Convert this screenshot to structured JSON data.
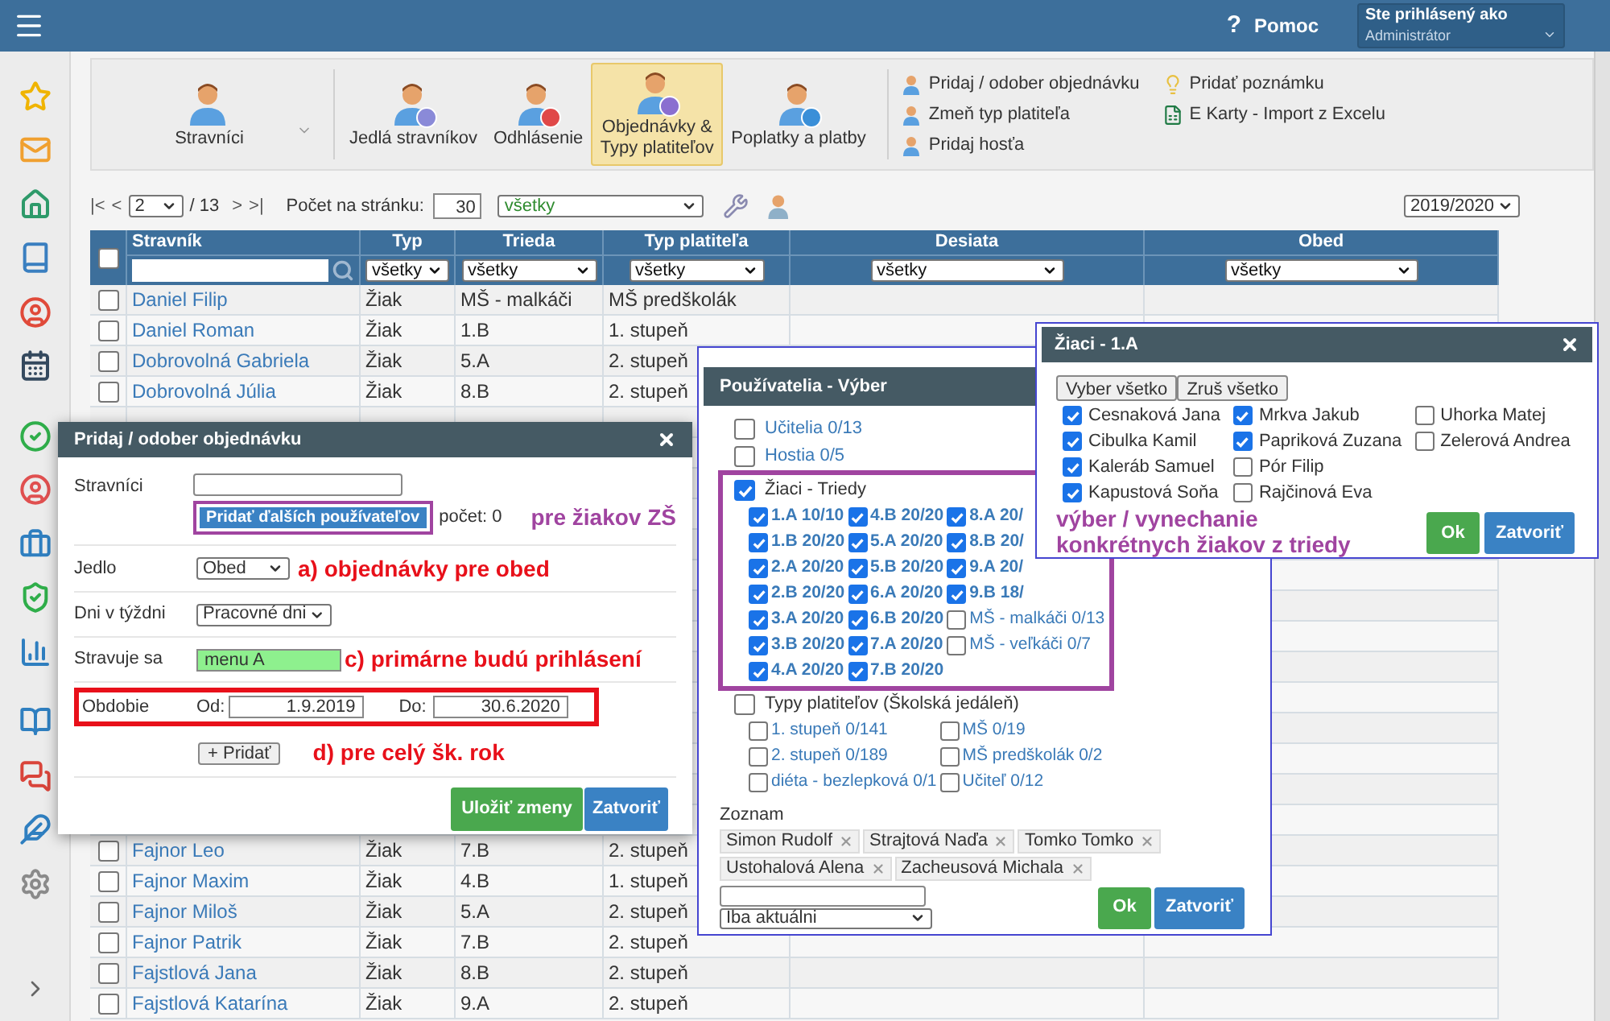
{
  "header": {
    "help_icon": "?",
    "help": "Pomoc",
    "user_label": "Ste prihlásený ako",
    "user_role": "Administrátor"
  },
  "toolbar": {
    "buttons": [
      {
        "label": "Stravníci",
        "selected": false,
        "dropdown": true
      },
      {
        "label": "Jedlá stravníkov",
        "selected": false,
        "dropdown": false
      },
      {
        "label": "Odhlásenie",
        "selected": false,
        "dropdown": false
      },
      {
        "label": "Objednávky & Typy platiteľov",
        "selected": true,
        "dropdown": false
      },
      {
        "label": "Poplatky a platby",
        "selected": false,
        "dropdown": false
      }
    ],
    "links": [
      "Pridaj / odober objednávku",
      "Zmeň typ platiteľa",
      "Pridaj hosťa",
      "Pridať poznámku",
      "E Karty - Import z Excelu"
    ]
  },
  "pager": {
    "first": "|<",
    "prev": "<",
    "page": "2",
    "total": "/ 13",
    "next": ">",
    "last": ">|",
    "per_page_label": "Počet na stránku:",
    "per_page": "30",
    "filter": "všetky",
    "year": "2019/2020"
  },
  "table": {
    "columns": [
      "Stravník",
      "Typ",
      "Trieda",
      "Typ platiteľa",
      "Desiata",
      "Obed"
    ],
    "all_checked": false,
    "filters": [
      "všetky",
      "všetky",
      "všetky",
      "všetky",
      "všetky"
    ],
    "rows_above": [
      {
        "name": "Daniel Filip",
        "type": "Žiak",
        "class": "MŠ - malkáči",
        "payer": "MŠ predškolák",
        "checked": false
      },
      {
        "name": "Daniel Roman",
        "type": "Žiak",
        "class": "1.B",
        "payer": "1. stupeň",
        "checked": false
      },
      {
        "name": "Dobrovolná Gabriela",
        "type": "Žiak",
        "class": "5.A",
        "payer": "2. stupeň",
        "checked": false
      },
      {
        "name": "Dobrovolná Júlia",
        "type": "Žiak",
        "class": "8.B",
        "payer": "2. stupeň",
        "checked": false
      }
    ],
    "rows_below": [
      {
        "name": "Fajnor Leo",
        "type": "Žiak",
        "class": "7.B",
        "payer": "2. stupeň",
        "checked": false
      },
      {
        "name": "Fajnor Maxim",
        "type": "Žiak",
        "class": "4.B",
        "payer": "1. stupeň",
        "checked": false
      },
      {
        "name": "Fajnor Miloš",
        "type": "Žiak",
        "class": "5.A",
        "payer": "2. stupeň",
        "checked": false
      },
      {
        "name": "Fajnor Patrik",
        "type": "Žiak",
        "class": "7.B",
        "payer": "2. stupeň",
        "checked": false
      },
      {
        "name": "Fajstlová Jana",
        "type": "Žiak",
        "class": "8.B",
        "payer": "2. stupeň",
        "checked": false
      },
      {
        "name": "Fajstlová Katarína",
        "type": "Žiak",
        "class": "9.A",
        "payer": "2. stupeň",
        "checked": false
      }
    ]
  },
  "order_dialog": {
    "title": "Pridaj / odober objednávku",
    "stravnici_label": "Stravníci",
    "add_users_button": "Pridať ďalších používateľov",
    "count": "počet: 0",
    "students_note": "pre žiakov ZŠ",
    "jedlo_label": "Jedlo",
    "jedlo_value": "Obed",
    "jedlo_note": "a) objednávky pre obed",
    "dni_label": "Dni v týždni",
    "dni_value": "Pracovné dni",
    "stravuje_label": "Stravuje sa",
    "stravuje_value": "menu A",
    "stravuje_note": "c)  primárne budú prihlásení",
    "obdobie_label": "Obdobie",
    "od_label": "Od:",
    "od_value": "1.9.2019",
    "do_label": "Do:",
    "do_value": "30.6.2020",
    "add_button": "+ Pridať",
    "obdobie_note": "d) pre celý šk. rok",
    "save_button": "Uložiť zmeny",
    "close_button": "Zatvoriť"
  },
  "users_dialog": {
    "title": "Používatelia - Výber",
    "groups": [
      {
        "label": "Učitelia 0/13",
        "checked": false
      },
      {
        "label": "Hostia 0/5",
        "checked": false
      },
      {
        "label": "Žiaci - Triedy",
        "checked": true,
        "kind": "classes",
        "children": [
          {
            "label": "1.A 10/10",
            "checked": true
          },
          {
            "label": "1.B 20/20",
            "checked": true
          },
          {
            "label": "2.A 20/20",
            "checked": true
          },
          {
            "label": "2.B 20/20",
            "checked": true
          },
          {
            "label": "3.A 20/20",
            "checked": true
          },
          {
            "label": "3.B 20/20",
            "checked": true
          },
          {
            "label": "4.A 20/20",
            "checked": true
          },
          {
            "label": "4.B 20/20",
            "checked": true
          },
          {
            "label": "5.A 20/20",
            "checked": true
          },
          {
            "label": "5.B 20/20",
            "checked": true
          },
          {
            "label": "6.A 20/20",
            "checked": true
          },
          {
            "label": "6.B 20/20",
            "checked": true
          },
          {
            "label": "7.A 20/20",
            "checked": true
          },
          {
            "label": "7.B 20/20",
            "checked": true
          },
          {
            "label": "8.A 20/",
            "checked": true
          },
          {
            "label": "8.B 20/",
            "checked": true
          },
          {
            "label": "9.A 20/",
            "checked": true
          },
          {
            "label": "9.B 18/",
            "checked": true
          },
          {
            "label": "MŠ - malkáči 0/13",
            "checked": false
          },
          {
            "label": "MŠ - veľkáči 0/7",
            "checked": false
          }
        ]
      },
      {
        "label": "Typy platiteľov (Školská jedáleň)",
        "checked": false,
        "kind": "payer_types",
        "children": [
          {
            "label": "1. stupeň 0/141",
            "checked": false
          },
          {
            "label": "2. stupeň 0/189",
            "checked": false
          },
          {
            "label": "diéta - bezlepková 0/1",
            "checked": false
          },
          {
            "label": "MŠ 0/19",
            "checked": false
          },
          {
            "label": "MŠ predškolák 0/2",
            "checked": false
          },
          {
            "label": "Učiteľ 0/12",
            "checked": false
          }
        ]
      }
    ],
    "list_label": "Zoznam",
    "tags": [
      "Simon Rudolf",
      "Strajtová Naďa",
      "Tomko Tomko",
      "Ustohalová Alena",
      "Zacheusová Michala"
    ],
    "filter": "Iba aktuálni",
    "ok_button": "Ok",
    "close_button": "Zatvoriť"
  },
  "students_dialog": {
    "title": "Žiaci - 1.A",
    "select_all": "Vyber všetko",
    "clear_all": "Zruš všetko",
    "students": [
      {
        "name": "Cesnaková Jana",
        "checked": true
      },
      {
        "name": "Cibulka Kamil",
        "checked": true
      },
      {
        "name": "Kaleráb Samuel",
        "checked": true
      },
      {
        "name": "Kapustová Soňa",
        "checked": true
      },
      {
        "name": "Mrkva Jakub",
        "checked": true
      },
      {
        "name": "Papriková Zuzana",
        "checked": true
      },
      {
        "name": "Pór Filip",
        "checked": false
      },
      {
        "name": "Rajčinová Eva",
        "checked": false
      },
      {
        "name": "Uhorka Matej",
        "checked": false
      },
      {
        "name": "Zelerová Andrea",
        "checked": false
      }
    ],
    "note": "výber  /  vynechanie konkrétnych žiakov z triedy",
    "ok_button": "Ok",
    "close_button": "Zatvoriť"
  }
}
